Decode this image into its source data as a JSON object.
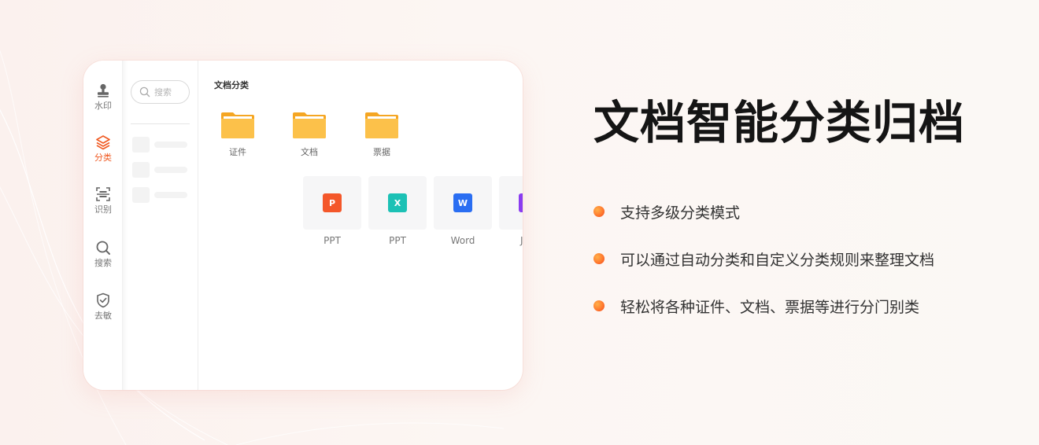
{
  "rail": {
    "items": [
      {
        "label": "水印",
        "icon": "stamp-icon",
        "active": false
      },
      {
        "label": "分类",
        "icon": "layers-icon",
        "active": true
      },
      {
        "label": "识别",
        "icon": "scan-icon",
        "active": false
      },
      {
        "label": "搜索",
        "icon": "search-icon",
        "active": false
      },
      {
        "label": "去敏",
        "icon": "shield-check-icon",
        "active": false
      }
    ]
  },
  "search": {
    "placeholder": "搜索"
  },
  "main": {
    "section_title": "文档分类",
    "folders": [
      {
        "label": "证件"
      },
      {
        "label": "文档"
      },
      {
        "label": "票据"
      }
    ],
    "files": [
      {
        "label": "PPT",
        "glyph": "P",
        "color": "#f4572a"
      },
      {
        "label": "PPT",
        "glyph": "X",
        "color": "#1cc1b5"
      },
      {
        "label": "Word",
        "glyph": "W",
        "color": "#2a6ef2"
      },
      {
        "label": "JPG",
        "glyph": "",
        "color": "#8a3cf0"
      }
    ]
  },
  "headline": "文档智能分类归档",
  "bullets": [
    "支持多级分类模式",
    "可以通过自动分类和自定义分类规则来整理文档",
    "轻松将各种证件、文档、票据等进行分门别类"
  ],
  "colors": {
    "accent": "#f05a22",
    "folder": "#fcc14a",
    "folder_dark": "#f5a623"
  }
}
